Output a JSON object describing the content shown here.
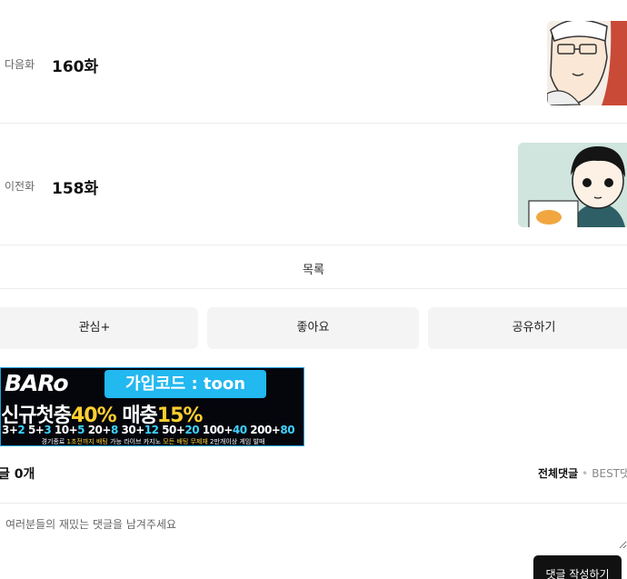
{
  "episodes": {
    "next": {
      "caption": "다음화",
      "title": "160화",
      "thumb_icon": "episode-160-thumbnail"
    },
    "prev": {
      "caption": "이전화",
      "title": "158화",
      "thumb_icon": "episode-158-thumbnail"
    }
  },
  "list_label": "목록",
  "actions": {
    "favorite": "관심+",
    "like": "좋아요",
    "share": "공유하기"
  },
  "banner": {
    "logo": "BARo",
    "code": "가입코드 : toon",
    "headline_a": "신규첫충",
    "headline_b": "40%",
    "headline_c": "매충",
    "headline_d": "15%",
    "bonus_1a": "3+",
    "bonus_1b": "2",
    "bonus_2a": " 5+",
    "bonus_2b": "3",
    "bonus_3a": " 10+",
    "bonus_3b": "5",
    "bonus_4a": " 20+",
    "bonus_4b": "8",
    "bonus_5a": " 30+",
    "bonus_5b": "12",
    "bonus_6a": " 50+",
    "bonus_6b": "20",
    "bonus_7a": " 100+",
    "bonus_7b": "40",
    "bonus_8a": " 200+",
    "bonus_8b": "80",
    "note_a": "경기종료 ",
    "note_b": "1초전까지 배팅",
    "note_c": " 가능 라이브 카지노 ",
    "note_d": "모든 배팅 무제재",
    "note_e": " 2만개이상 게임 발매"
  },
  "comments": {
    "count_label": "글 0개",
    "tab_all": "전체댓글",
    "tab_separator": "•",
    "tab_best": "BEST댓",
    "placeholder": "여러분들의 재밌는 댓글을 남겨주세요",
    "submit": "댓글 작성하기"
  },
  "colors": {
    "banner_accent": "#22b8f0",
    "banner_highlight": "#ffcf2e",
    "submit_bg": "#111111",
    "button_bg": "#f4f4f4"
  }
}
